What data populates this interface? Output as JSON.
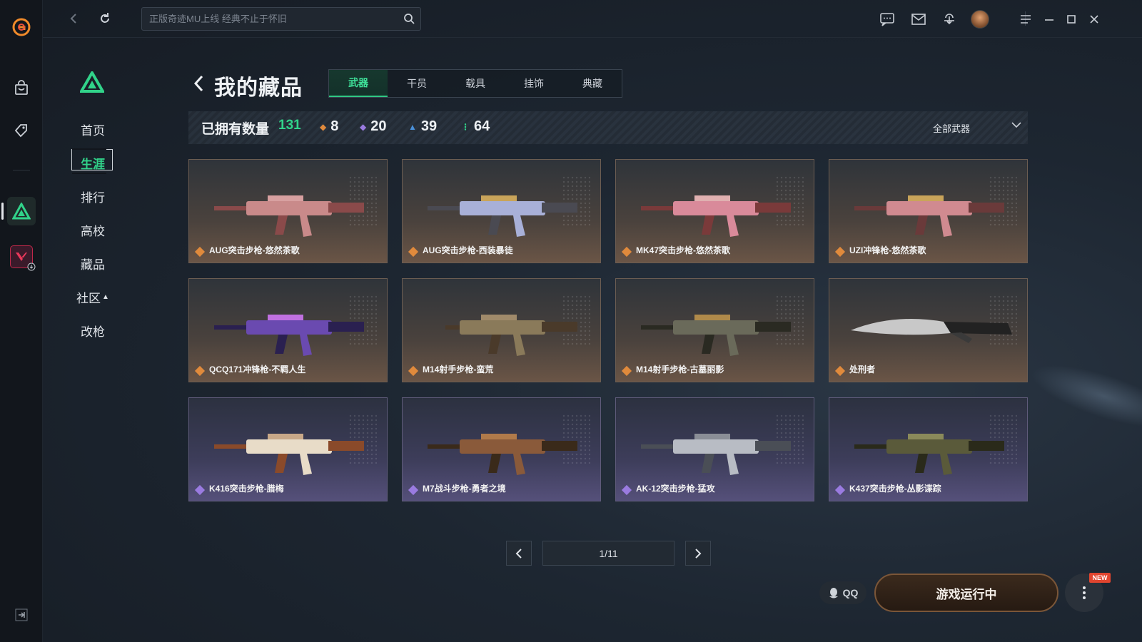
{
  "search": {
    "placeholder": "正版奇迹MU上线 经典不止于怀旧"
  },
  "subnav": {
    "items": [
      {
        "label": "首页"
      },
      {
        "label": "生涯"
      },
      {
        "label": "排行"
      },
      {
        "label": "高校"
      },
      {
        "label": "藏品"
      },
      {
        "label": "社区"
      },
      {
        "label": "改枪"
      }
    ]
  },
  "page": {
    "title": "我的藏品",
    "tabs": [
      {
        "label": "武器"
      },
      {
        "label": "干员"
      },
      {
        "label": "载具"
      },
      {
        "label": "挂饰"
      },
      {
        "label": "典藏"
      }
    ]
  },
  "stats": {
    "owned_label": "已拥有数量",
    "owned_count": "131",
    "rarities": [
      {
        "value": "8",
        "color": "#e08a3c"
      },
      {
        "value": "20",
        "color": "#9a7be0"
      },
      {
        "value": "39",
        "color": "#4a90d9"
      },
      {
        "value": "64",
        "color": "#31d38a"
      }
    ],
    "filter_label": "全部武器"
  },
  "items": [
    {
      "name": "AUG突击步枪-悠然茶歌",
      "rarity": "orange"
    },
    {
      "name": "AUG突击步枪-西装暴徒",
      "rarity": "orange"
    },
    {
      "name": "MK47突击步枪-悠然茶歌",
      "rarity": "orange"
    },
    {
      "name": "UZI冲锋枪-悠然茶歌",
      "rarity": "orange"
    },
    {
      "name": "QCQ171冲锋枪-不羁人生",
      "rarity": "orange"
    },
    {
      "name": "M14射手步枪-蛮荒",
      "rarity": "orange"
    },
    {
      "name": "M14射手步枪-古墓丽影",
      "rarity": "orange"
    },
    {
      "name": "处刑者",
      "rarity": "orange"
    },
    {
      "name": "K416突击步枪-腊梅",
      "rarity": "purple"
    },
    {
      "name": "M7战斗步枪-勇者之境",
      "rarity": "purple"
    },
    {
      "name": "AK-12突击步枪-猛攻",
      "rarity": "purple"
    },
    {
      "name": "K437突击步枪-丛影谍踪",
      "rarity": "purple"
    }
  ],
  "pagination": {
    "label": "1/11"
  },
  "footer": {
    "qq_label": "QQ",
    "run_label": "游戏运行中",
    "new_badge": "NEW"
  },
  "colors": {
    "accent": "#31d38a",
    "orange_rarity": "#e08a3c",
    "purple_rarity": "#9a7be0"
  }
}
